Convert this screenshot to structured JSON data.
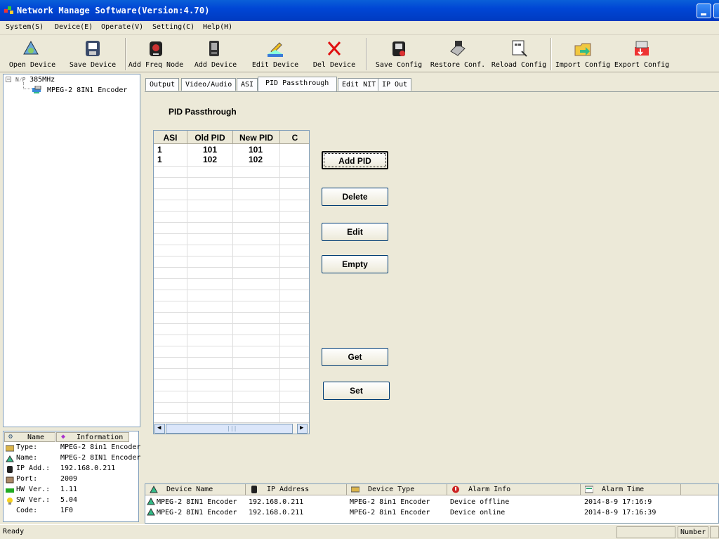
{
  "window": {
    "title": "Network Manage Software(Version:4.70)"
  },
  "menu": [
    "System(S)",
    "Device(E)",
    "Operate(V)",
    "Setting(C)",
    "Help(H)"
  ],
  "toolbar": [
    {
      "label": "Open Device",
      "icon": "open-device-icon"
    },
    {
      "label": "Save Device",
      "icon": "save-device-icon"
    },
    {
      "label": "Add Freq Node",
      "icon": "add-freq-node-icon"
    },
    {
      "label": "Add Device",
      "icon": "add-device-icon"
    },
    {
      "label": "Edit Device",
      "icon": "edit-device-icon"
    },
    {
      "label": "Del Device",
      "icon": "delete-icon"
    },
    {
      "label": "Save Config",
      "icon": "save-config-icon"
    },
    {
      "label": "Restore Conf.",
      "icon": "restore-config-icon"
    },
    {
      "label": "Reload Config",
      "icon": "reload-config-icon"
    },
    {
      "label": "Import Config",
      "icon": "import-config-icon"
    },
    {
      "label": "Export Config",
      "icon": "export-config-icon"
    }
  ],
  "tree": {
    "root": "385MHz",
    "child": "MPEG-2 8IN1 Encoder"
  },
  "info": {
    "headers": [
      "Name",
      "Information"
    ],
    "rows": [
      {
        "key": "Type:",
        "value": "MPEG-2 8in1 Encoder",
        "icon": "type-icon"
      },
      {
        "key": "Name:",
        "value": "MPEG-2 8IN1 Encoder",
        "icon": "name-icon"
      },
      {
        "key": "IP Add.:",
        "value": "192.168.0.211",
        "icon": "ip-icon"
      },
      {
        "key": "Port:",
        "value": "2009",
        "icon": "port-icon"
      },
      {
        "key": "HW Ver.:",
        "value": "1.11",
        "icon": "hw-icon"
      },
      {
        "key": "SW Ver.:",
        "value": "5.04",
        "icon": "sw-icon"
      },
      {
        "key": "Code:",
        "value": "1F0",
        "icon": ""
      }
    ]
  },
  "tabs": [
    "Output",
    "Video/Audio",
    "ASI",
    "PID Passthrough",
    "Edit NIT",
    "IP Out"
  ],
  "active_tab": "PID Passthrough",
  "section_title": "PID Passthrough",
  "pid_table": {
    "headers": [
      "ASI",
      "Old PID",
      "New PID",
      "C"
    ],
    "rows": [
      [
        "1",
        "101",
        "101"
      ],
      [
        "1",
        "102",
        "102"
      ]
    ]
  },
  "buttons": {
    "add_pid": "Add PID",
    "delete": "Delete",
    "edit": "Edit",
    "empty": "Empty",
    "get": "Get",
    "set": "Set"
  },
  "alarm": {
    "headers": [
      "Device Name",
      "IP Address",
      "Device Type",
      "Alarm Info",
      "Alarm Time"
    ],
    "rows": [
      [
        "MPEG-2 8IN1 Encoder",
        "192.168.0.211",
        "MPEG-2 8in1 Encoder",
        "Device offline",
        "2014-8-9 17:16:9"
      ],
      [
        "MPEG-2 8IN1 Encoder",
        "192.168.0.211",
        "MPEG-2 8in1 Encoder",
        "Device online",
        "2014-8-9 17:16:39"
      ]
    ]
  },
  "status": {
    "ready": "Ready",
    "num": "Number"
  },
  "colors": {
    "title_bar": "#0046d5",
    "face": "#ece9d8",
    "border": "#7f9db9"
  }
}
